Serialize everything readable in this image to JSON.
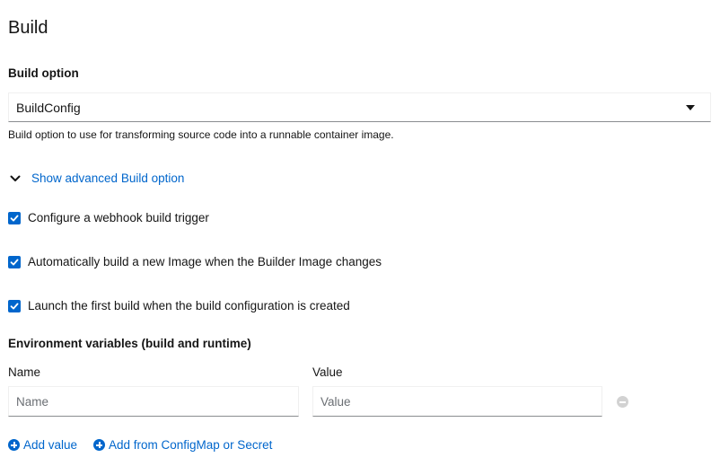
{
  "page": {
    "title": "Build"
  },
  "build_option": {
    "label": "Build option",
    "selected_value": "BuildConfig",
    "helper_text": "Build option to use for transforming source code into a runnable container image."
  },
  "advanced": {
    "toggle_label": "Show advanced Build option"
  },
  "checkboxes": [
    {
      "label": "Configure a webhook build trigger",
      "checked": true
    },
    {
      "label": "Automatically build a new Image when the Builder Image changes",
      "checked": true
    },
    {
      "label": "Launch the first build when the build configuration is created",
      "checked": true
    }
  ],
  "env_vars": {
    "heading": "Environment variables (build and runtime)",
    "name_label": "Name",
    "value_label": "Value",
    "name_placeholder": "Name",
    "value_placeholder": "Value",
    "name_value": "",
    "value_value": ""
  },
  "actions": {
    "add_value": "Add value",
    "add_from_configmap": "Add from ConfigMap or Secret"
  },
  "colors": {
    "accent": "#0066cc",
    "text": "#151515",
    "muted": "#6a6e73",
    "remove_icon": "#d2d2d2"
  }
}
